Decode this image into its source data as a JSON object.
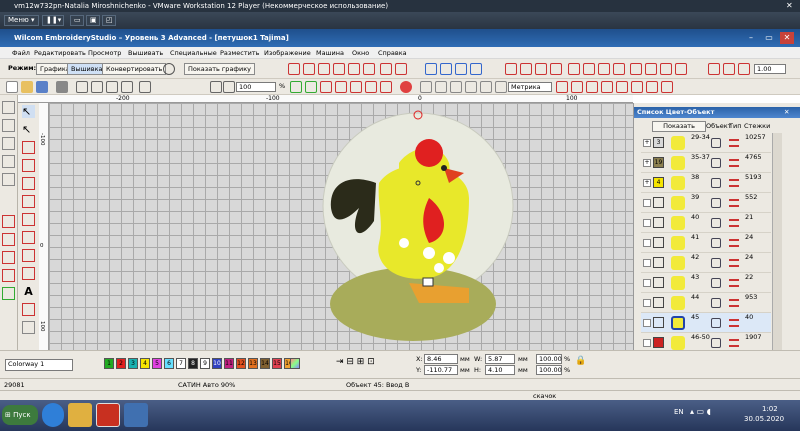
{
  "vm": {
    "title": "vm12w732pn-Natalia Miroshnichenko - VMware Workstation 12 Player (Некоммерческое использование)",
    "menu_label": "Меню"
  },
  "app": {
    "title": "Wilcom EmbroideryStudio – Уровень 3 Advanced - [петушок1    Tajima]"
  },
  "menu": [
    "Файл",
    "Редактировать",
    "Просмотр",
    "Вышивать",
    "Специальные",
    "Разместить",
    "Изображение",
    "Машина",
    "Окно",
    "Справка"
  ],
  "toolbar": {
    "mode_label": "Режим:",
    "mode_graphic": "Графика",
    "mode_embroidery": "Вышивка",
    "convert": "Конвертировать",
    "show_graphic": "Показать графику",
    "zoom_value": "100",
    "zoom_unit": "%",
    "metric": "Метрика",
    "scale_value": "1.00"
  },
  "ruler": {
    "top_ticks": [
      "-200",
      "-100",
      "0",
      "100"
    ],
    "left_ticks": [
      "-100",
      "0",
      "100"
    ]
  },
  "panel": {
    "title": "Список Цвет-Объект",
    "show_button": "Показать",
    "col_object": "Объект",
    "col_type": "Тип",
    "col_stitches": "Стежки",
    "rows": [
      {
        "color_num": "3",
        "objects": "29-34",
        "stitches": "10257",
        "swatch": "#d8d8d8"
      },
      {
        "color_num": "19",
        "objects": "35-37",
        "stitches": "4765",
        "swatch": "#8c8050"
      },
      {
        "color_num": "4",
        "objects": "38",
        "stitches": "5193",
        "swatch": "#f5e400"
      },
      {
        "color_num": "",
        "objects": "39",
        "stitches": "552",
        "swatch": ""
      },
      {
        "color_num": "",
        "objects": "40",
        "stitches": "21",
        "swatch": ""
      },
      {
        "color_num": "",
        "objects": "41",
        "stitches": "24",
        "swatch": ""
      },
      {
        "color_num": "",
        "objects": "42",
        "stitches": "24",
        "swatch": ""
      },
      {
        "color_num": "",
        "objects": "43",
        "stitches": "22",
        "swatch": ""
      },
      {
        "color_num": "",
        "objects": "44",
        "stitches": "953",
        "swatch": ""
      },
      {
        "color_num": "",
        "objects": "45",
        "stitches": "40",
        "swatch": ""
      },
      {
        "color_num": "",
        "objects": "46-50",
        "stitches": "1907",
        "swatch": "#cc2222"
      }
    ]
  },
  "bottom": {
    "colorway": "Colorway 1",
    "swatches": [
      {
        "n": "1",
        "c": "#22aa22"
      },
      {
        "n": "2",
        "c": "#e02020"
      },
      {
        "n": "3",
        "c": "#18b0b0"
      },
      {
        "n": "4",
        "c": "#f5e400"
      },
      {
        "n": "5",
        "c": "#e040e0"
      },
      {
        "n": "6",
        "c": "#66e0ff"
      },
      {
        "n": "7",
        "c": "#ffffff"
      },
      {
        "n": "8",
        "c": "#222222"
      },
      {
        "n": "9",
        "c": "#ffffff"
      },
      {
        "n": "10",
        "c": "#3040c0"
      },
      {
        "n": "11",
        "c": "#c02080"
      },
      {
        "n": "12",
        "c": "#e05020"
      },
      {
        "n": "13",
        "c": "#e07020"
      },
      {
        "n": "14",
        "c": "#806030"
      },
      {
        "n": "15",
        "c": "#e04050"
      },
      {
        "n": "16",
        "c": "#f0a030"
      }
    ],
    "x_label": "X:",
    "x_value": "8.46",
    "y_label": "Y:",
    "y_value": "-110.77",
    "w_label": "W:",
    "w_value": "5.87",
    "h_label": "H:",
    "h_value": "4.10",
    "unit": "мм",
    "w_percent": "100.00",
    "h_percent": "100.00",
    "percent": "%"
  },
  "status": {
    "left": "29081",
    "stitch_type": "САТИН Авто 90%",
    "object": "Объект 45: Ввод В",
    "jump": "скачок"
  },
  "taskbar": {
    "start": "Пуск",
    "lang": "EN",
    "time": "1:02",
    "date": "30.05.2020"
  }
}
